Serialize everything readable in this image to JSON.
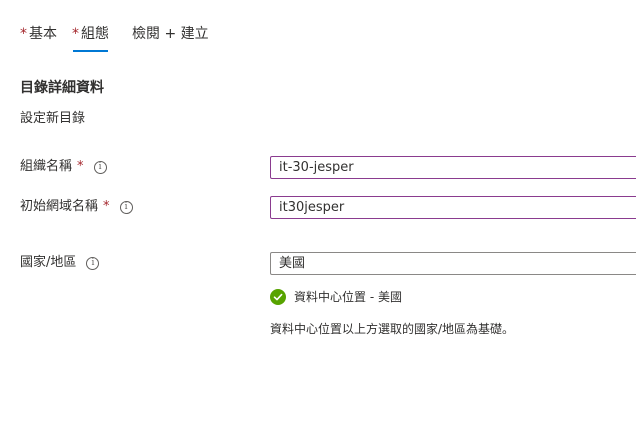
{
  "tabs": [
    {
      "label": "基本",
      "required": "*"
    },
    {
      "label": "組態",
      "required": "*"
    },
    {
      "label": "檢閱 + 建立"
    }
  ],
  "section": {
    "title": "目錄詳細資料",
    "subtitle": "設定新目錄"
  },
  "fields": {
    "org_name": {
      "label": "組織名稱",
      "required": "*",
      "value": "it-30-jesper"
    },
    "domain_name": {
      "label": "初始網域名稱",
      "required": "*",
      "value": "it30jesper"
    },
    "country": {
      "label": "國家/地區",
      "value": "美國"
    }
  },
  "datacenter": {
    "status": "資料中心位置 - 美國",
    "help": "資料中心位置以上方選取的國家/地區為基礎。"
  },
  "icons": {
    "info": "info-icon",
    "success": "checkmark-circle-icon"
  },
  "colors": {
    "accent": "#0078d4",
    "required": "#a4262c",
    "success": "#57a300",
    "input_focus_border": "#8a3b8f"
  }
}
